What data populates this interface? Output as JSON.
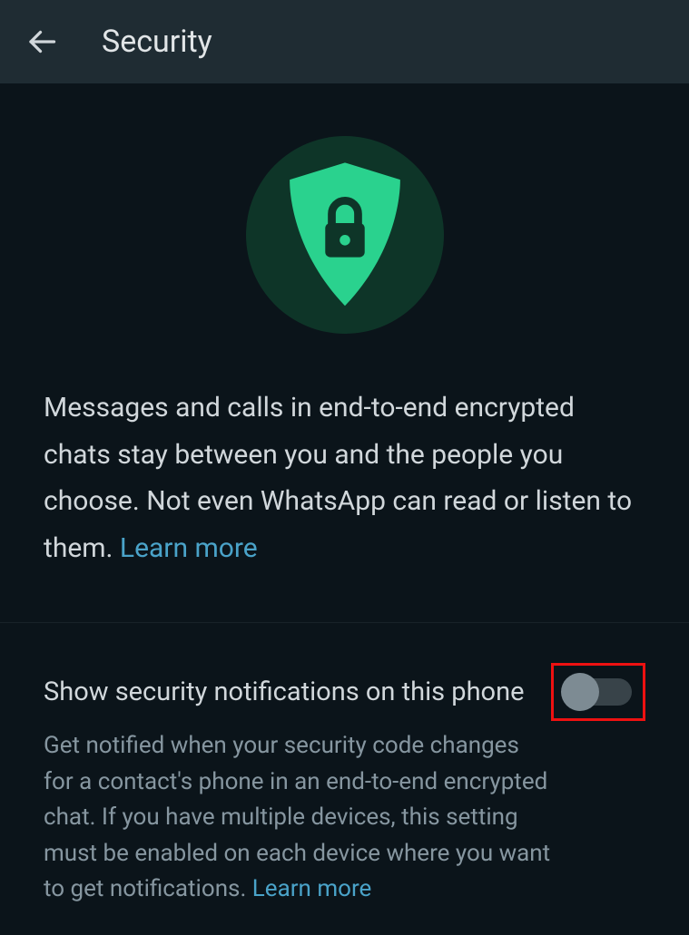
{
  "header": {
    "title": "Security"
  },
  "hero": {
    "description": "Messages and calls in end-to-end encrypted chats stay between you and the people you choose. Not even WhatsApp can read or listen to them. ",
    "learn_more": "Learn more"
  },
  "setting": {
    "title": "Show security notifications on this phone",
    "description": "Get notified when your security code changes for a contact's phone in an end-to-end encrypted chat. If you have multiple devices, this setting must be enabled on each device where you want to get notifications. ",
    "learn_more": "Learn more",
    "toggle_on": false
  },
  "colors": {
    "accent": "#2ad28e",
    "link": "#4aa3c9",
    "highlight_border": "#e11"
  }
}
